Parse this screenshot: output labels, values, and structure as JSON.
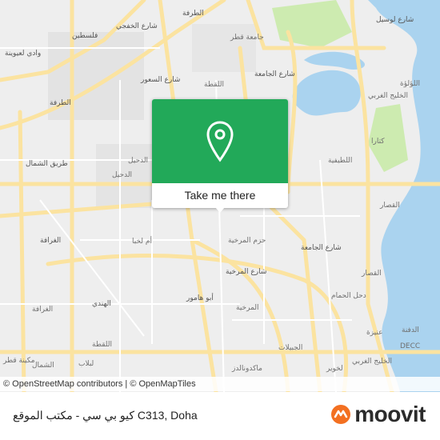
{
  "map": {
    "labels": [
      {
        "text": "الطرفة",
        "kind": "road"
      },
      {
        "text": "شارع الخفجي",
        "kind": "road"
      },
      {
        "text": "فلسطين",
        "kind": "road"
      },
      {
        "text": "وادي لعيوينة",
        "kind": "road"
      },
      {
        "text": "جامعة قطر",
        "kind": "place"
      },
      {
        "text": "شارع الجامعة",
        "kind": "road"
      },
      {
        "text": "شارع السعور",
        "kind": "road"
      },
      {
        "text": "اللقطة",
        "kind": "place"
      },
      {
        "text": "شارع لوسيل",
        "kind": "road"
      },
      {
        "text": "اللؤلؤة",
        "kind": "place"
      },
      {
        "text": "الخليج الغربي",
        "kind": "place"
      },
      {
        "text": "الطرفة",
        "kind": "road"
      },
      {
        "text": "الدحيل",
        "kind": "place"
      },
      {
        "text": "الدحيل",
        "kind": "place"
      },
      {
        "text": "كتارا",
        "kind": "place"
      },
      {
        "text": "اللطيفية",
        "kind": "place"
      },
      {
        "text": "طريق الشمال",
        "kind": "road"
      },
      {
        "text": "الغرافة",
        "kind": "road"
      },
      {
        "text": "أم لخبا",
        "kind": "place"
      },
      {
        "text": "حزم المرخية",
        "kind": "place"
      },
      {
        "text": "القصار",
        "kind": "place"
      },
      {
        "text": "شارع المرخية",
        "kind": "road"
      },
      {
        "text": "شارع الجامعة",
        "kind": "road"
      },
      {
        "text": "القصار",
        "kind": "place"
      },
      {
        "text": "الغرافة",
        "kind": "place"
      },
      {
        "text": "الهندي",
        "kind": "road"
      },
      {
        "text": "المرخية",
        "kind": "place"
      },
      {
        "text": "أبو هامور",
        "kind": "road"
      },
      {
        "text": "دحل الحمام",
        "kind": "place"
      },
      {
        "text": "الدفنة",
        "kind": "place"
      },
      {
        "text": "عنيزة",
        "kind": "place"
      },
      {
        "text": "DECC",
        "kind": "place"
      },
      {
        "text": "اللقطة",
        "kind": "place"
      },
      {
        "text": "الجبيلات",
        "kind": "place"
      },
      {
        "text": "لخوير",
        "kind": "place"
      },
      {
        "text": "الخليج الغربي",
        "kind": "place"
      },
      {
        "text": "مكينة قطر",
        "kind": "place"
      },
      {
        "text": "الشمال",
        "kind": "place"
      },
      {
        "text": "لبلاب",
        "kind": "place"
      },
      {
        "text": "ماكدونالدز",
        "kind": "place"
      }
    ]
  },
  "marker": {
    "button_label": "Take me there"
  },
  "attribution": {
    "osm": "© OpenStreetMap contributors",
    "sep": " | ",
    "tiles": "© OpenMapTiles"
  },
  "footer": {
    "title": "كيو بي سي - مكتب الموقع C313, Doha",
    "logo_text": "moovit"
  },
  "colors": {
    "marker_green": "#22a959",
    "water": "#aad3ef",
    "park": "#cdebb0",
    "road_major": "#fbe3a0",
    "logo_orange": "#f37021"
  }
}
